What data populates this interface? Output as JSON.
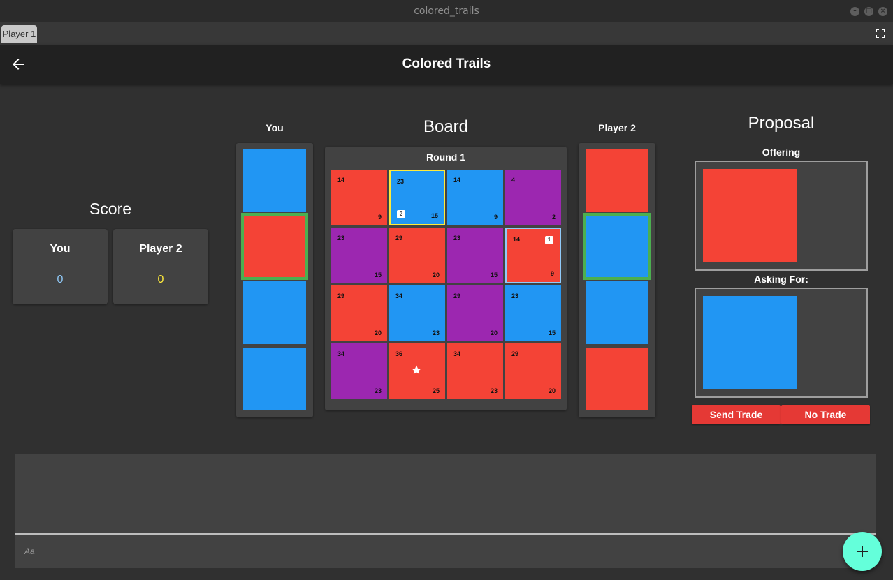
{
  "window": {
    "title": "colored_trails"
  },
  "tabs": {
    "active": "Player 1"
  },
  "appbar": {
    "title": "Colored Trails"
  },
  "colors": {
    "red": "#f44336",
    "blue": "#2196f3",
    "purple": "#9c27b0",
    "you_score": "#90caf9",
    "p2_score": "#ffeb3b",
    "fab": "#64ffda",
    "button": "#e53935"
  },
  "score": {
    "heading": "Score",
    "you": {
      "label": "You",
      "value": "0"
    },
    "player2": {
      "label": "Player 2",
      "value": "0"
    }
  },
  "you_chips": {
    "heading": "You",
    "chips": [
      "blue",
      "red",
      "blue",
      "blue"
    ],
    "selected_index": 1
  },
  "player2_chips": {
    "heading": "Player 2",
    "chips": [
      "red",
      "blue",
      "blue",
      "red"
    ],
    "selected_index": 1
  },
  "board": {
    "heading": "Board",
    "round": "Round 1",
    "cells": [
      {
        "color": "red",
        "tl": "14",
        "br": "9"
      },
      {
        "color": "blue",
        "tl": "23",
        "br": "15",
        "badge": "2",
        "highlight": "yellow"
      },
      {
        "color": "blue",
        "tl": "14",
        "br": "9"
      },
      {
        "color": "purple",
        "tl": "4",
        "br": "2"
      },
      {
        "color": "purple",
        "tl": "23",
        "br": "15"
      },
      {
        "color": "red",
        "tl": "29",
        "br": "20"
      },
      {
        "color": "purple",
        "tl": "23",
        "br": "15"
      },
      {
        "color": "red",
        "tl": "14",
        "br": "9",
        "badge": "1",
        "highlight": "blue"
      },
      {
        "color": "red",
        "tl": "29",
        "br": "20"
      },
      {
        "color": "blue",
        "tl": "34",
        "br": "23"
      },
      {
        "color": "purple",
        "tl": "29",
        "br": "20"
      },
      {
        "color": "blue",
        "tl": "23",
        "br": "15"
      },
      {
        "color": "purple",
        "tl": "34",
        "br": "23"
      },
      {
        "color": "red",
        "tl": "36",
        "br": "25",
        "goal": true
      },
      {
        "color": "red",
        "tl": "34",
        "br": "23"
      },
      {
        "color": "red",
        "tl": "29",
        "br": "20"
      }
    ]
  },
  "proposal": {
    "heading": "Proposal",
    "offering_label": "Offering",
    "offering_chip": "red",
    "asking_label": "Asking For:",
    "asking_chip": "blue",
    "send_label": "Send Trade",
    "no_trade_label": "No Trade"
  },
  "chat": {
    "placeholder": "Aa"
  },
  "fab": {
    "icon": "plus-icon"
  }
}
